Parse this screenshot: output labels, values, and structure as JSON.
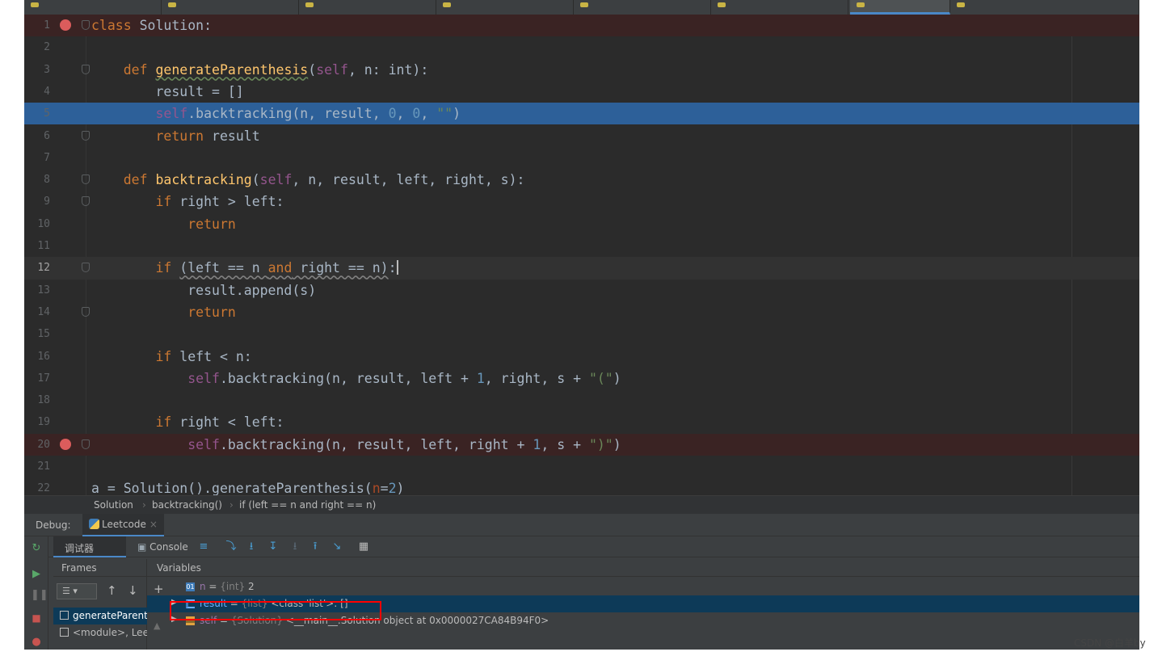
{
  "editor": {
    "current_line": 12,
    "lines": [
      {
        "n": "1"
      },
      {
        "n": "2"
      },
      {
        "n": "3"
      },
      {
        "n": "4"
      },
      {
        "n": "5"
      },
      {
        "n": "6"
      },
      {
        "n": "7"
      },
      {
        "n": "8"
      },
      {
        "n": "9"
      },
      {
        "n": "10"
      },
      {
        "n": "11"
      },
      {
        "n": "12"
      },
      {
        "n": "13"
      },
      {
        "n": "14"
      },
      {
        "n": "15"
      },
      {
        "n": "16"
      },
      {
        "n": "17"
      },
      {
        "n": "18"
      },
      {
        "n": "19"
      },
      {
        "n": "20"
      },
      {
        "n": "21"
      },
      {
        "n": "22"
      }
    ],
    "breakpoints": [
      1,
      20
    ],
    "execution_line": 5
  },
  "breadcrumb": {
    "item1": "Solution",
    "item2": "backtracking()",
    "item3": "if (left == n and right == n)"
  },
  "debug": {
    "label": "Debug:",
    "session_tab": "Leetcode",
    "close": "×",
    "debugger_tab": "调试器",
    "console_tab": "Console",
    "frames_header": "Frames",
    "variables_header": "Variables",
    "frames": [
      {
        "label": "generateParent",
        "selected": true
      },
      {
        "label": "<module>, Lee",
        "selected": false
      }
    ],
    "variables": [
      {
        "name": "n",
        "type": "{int}",
        "value": "2",
        "expandable": false,
        "selected": false
      },
      {
        "name": "result",
        "type": "{list}",
        "value": "<class 'list'>: []",
        "expandable": true,
        "selected": true
      },
      {
        "name": "self",
        "type": "{Solution}",
        "value": "<__main__.Solution object at 0x0000027CA84B94F0>",
        "expandable": true,
        "selected": false
      }
    ]
  },
  "watermark": "CSDN @白羊by",
  "colors": {
    "background": "#2b2b2b",
    "keyword": "#cc7832",
    "function": "#ffc66d",
    "self": "#94558d",
    "number": "#6897bb",
    "string": "#6a8759",
    "execution_line": "#2d6099",
    "breakpoint": "#db5c5c",
    "highlight_box": "#ff0000"
  }
}
